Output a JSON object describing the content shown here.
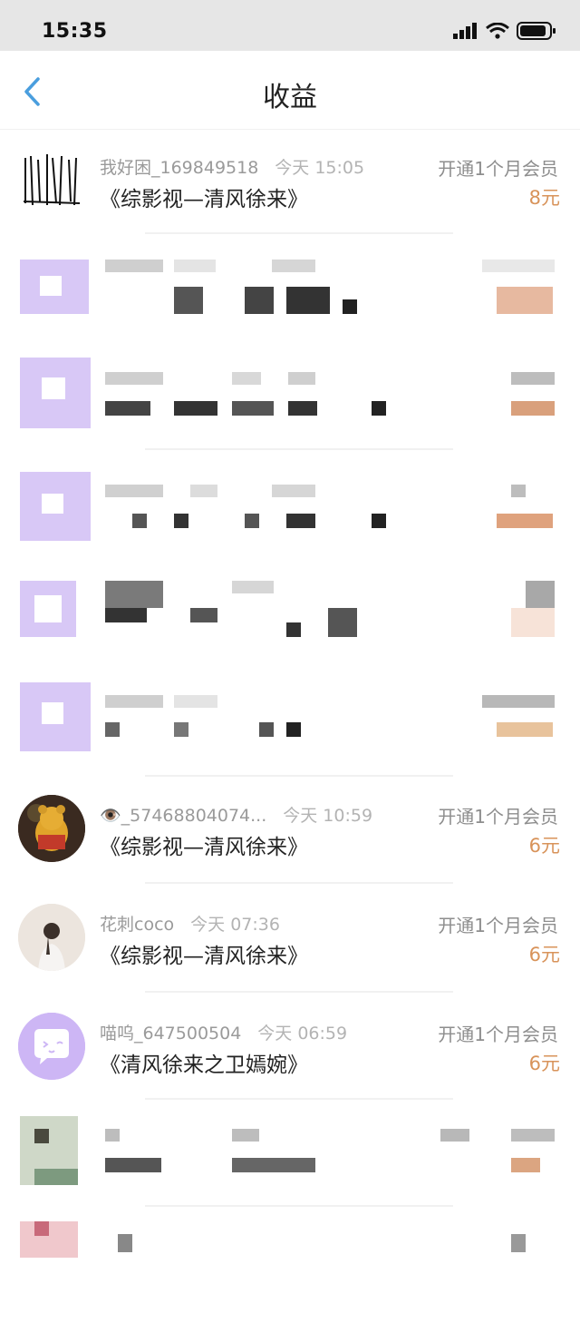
{
  "status": {
    "time": "15:35"
  },
  "nav": {
    "title": "收益",
    "back_icon": "chevron-left-icon"
  },
  "colors": {
    "accent": "#4a9ede",
    "price": "#d8935a",
    "avatar_purple": "#d8c8f6"
  },
  "rows": [
    {
      "user": "我好困_169849518",
      "time": "今天 15:05",
      "work": "《综影视—清风徐来》",
      "action": "开通1个月会员",
      "amount": "8元"
    },
    {
      "user": "👁️_57468804074...",
      "time": "今天 10:59",
      "work": "《综影视—清风徐来》",
      "action": "开通1个月会员",
      "amount": "6元"
    },
    {
      "user": "花刺coco",
      "time": "今天 07:36",
      "work": "《综影视—清风徐来》",
      "action": "开通1个月会员",
      "amount": "6元"
    },
    {
      "user": "喵呜_647500504",
      "time": "今天 06:59",
      "work": "《清风徐来之卫嫣婉》",
      "action": "开通1个月会员",
      "amount": "6元"
    }
  ]
}
